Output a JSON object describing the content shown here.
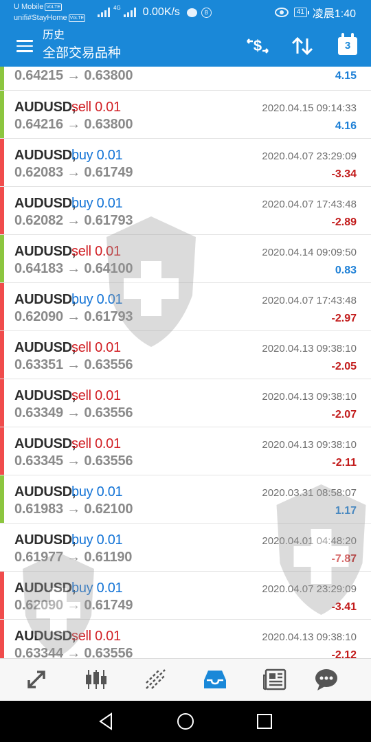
{
  "status_bar": {
    "carrier": "U Mobile",
    "carrier_tag": "VoLTE",
    "network_name": "unifi#StayHome",
    "network_tag": "VoLTE",
    "signal_tag": "4G",
    "speed": "0.00K/s",
    "battery": "41",
    "time": "凌晨1:40"
  },
  "app_bar": {
    "title": "历史",
    "subtitle": "全部交易品种",
    "menu_icon": "hamburger-menu-icon",
    "actions": [
      {
        "icon": "currency-exchange-icon"
      },
      {
        "icon": "sort-arrows-icon"
      },
      {
        "icon": "calendar-icon",
        "label": "3"
      }
    ]
  },
  "colors": {
    "primary": "#1a88d8",
    "sell": "#d11f24",
    "buy": "#1273d6",
    "profit_positive": "#1c7fd6",
    "profit_negative": "#c21a1a",
    "bar_green": "#8cc63f",
    "bar_red": "#f04c4c"
  },
  "trades": [
    {
      "symbol": "",
      "side": "",
      "lots": "",
      "open": "0.64215",
      "close": "0.63800",
      "time": "",
      "profit": "4.15",
      "bar": "green"
    },
    {
      "symbol": "AUDUSD,",
      "side": "sell",
      "lots": "0.01",
      "open": "0.64216",
      "close": "0.63800",
      "time": "2020.04.15 09:14:33",
      "profit": "4.16",
      "bar": "green"
    },
    {
      "symbol": "AUDUSD,",
      "side": "buy",
      "lots": "0.01",
      "open": "0.62083",
      "close": "0.61749",
      "time": "2020.04.07 23:29:09",
      "profit": "-3.34",
      "bar": "red"
    },
    {
      "symbol": "AUDUSD,",
      "side": "buy",
      "lots": "0.01",
      "open": "0.62082",
      "close": "0.61793",
      "time": "2020.04.07 17:43:48",
      "profit": "-2.89",
      "bar": "red"
    },
    {
      "symbol": "AUDUSD,",
      "side": "sell",
      "lots": "0.01",
      "open": "0.64183",
      "close": "0.64100",
      "time": "2020.04.14 09:09:50",
      "profit": "0.83",
      "bar": "green"
    },
    {
      "symbol": "AUDUSD,",
      "side": "buy",
      "lots": "0.01",
      "open": "0.62090",
      "close": "0.61793",
      "time": "2020.04.07 17:43:48",
      "profit": "-2.97",
      "bar": "red"
    },
    {
      "symbol": "AUDUSD,",
      "side": "sell",
      "lots": "0.01",
      "open": "0.63351",
      "close": "0.63556",
      "time": "2020.04.13 09:38:10",
      "profit": "-2.05",
      "bar": "red"
    },
    {
      "symbol": "AUDUSD,",
      "side": "sell",
      "lots": "0.01",
      "open": "0.63349",
      "close": "0.63556",
      "time": "2020.04.13 09:38:10",
      "profit": "-2.07",
      "bar": "red"
    },
    {
      "symbol": "AUDUSD,",
      "side": "sell",
      "lots": "0.01",
      "open": "0.63345",
      "close": "0.63556",
      "time": "2020.04.13 09:38:10",
      "profit": "-2.11",
      "bar": "red"
    },
    {
      "symbol": "AUDUSD,",
      "side": "buy",
      "lots": "0.01",
      "open": "0.61983",
      "close": "0.62100",
      "time": "2020.03.31 08:58:07",
      "profit": "1.17",
      "bar": "green"
    },
    {
      "symbol": "AUDUSD,",
      "side": "buy",
      "lots": "0.01",
      "open": "0.61977",
      "close": "0.61190",
      "time": "2020.04.01 04:48:20",
      "profit": "-7.87",
      "bar": "none"
    },
    {
      "symbol": "AUDUSD,",
      "side": "buy",
      "lots": "0.01",
      "open": "0.62090",
      "close": "0.61749",
      "time": "2020.04.07 23:29:09",
      "profit": "-3.41",
      "bar": "red"
    },
    {
      "symbol": "AUDUSD,",
      "side": "sell",
      "lots": "0.01",
      "open": "0.63344",
      "close": "0.63556",
      "time": "2020.04.13 09:38:10",
      "profit": "-2.12",
      "bar": "red"
    }
  ],
  "bottom_nav": [
    {
      "icon": "quotes-arrows-icon",
      "active": false
    },
    {
      "icon": "candlestick-chart-icon",
      "active": false
    },
    {
      "icon": "trade-line-chart-icon",
      "active": false
    },
    {
      "icon": "history-inbox-icon",
      "active": true
    },
    {
      "icon": "news-icon",
      "active": false
    },
    {
      "icon": "chat-bubble-icon",
      "active": false
    }
  ],
  "system_nav": [
    {
      "icon": "back-triangle-icon"
    },
    {
      "icon": "home-circle-icon"
    },
    {
      "icon": "recents-square-icon"
    }
  ]
}
